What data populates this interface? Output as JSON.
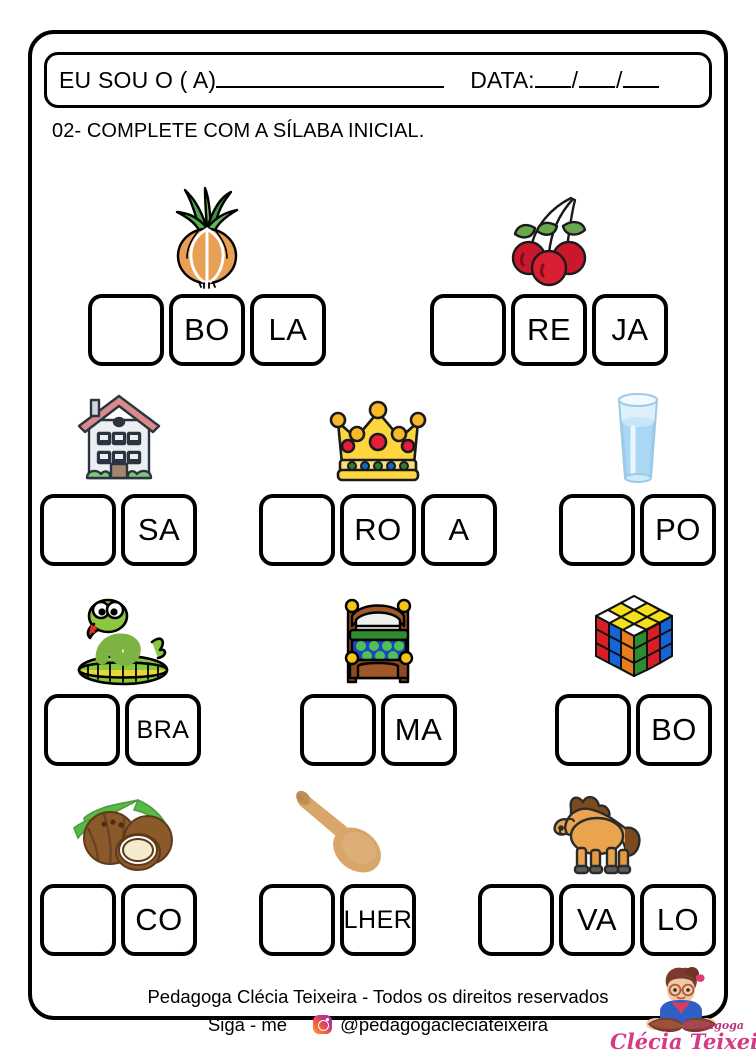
{
  "header": {
    "name_label": "EU SOU O ( A)",
    "date_label": "DATA:",
    "slash": "/"
  },
  "instruction": "02- COMPLETE  COM A SÍLABA INICIAL.",
  "exercise_rows": [
    {
      "row_index": 1,
      "items": [
        {
          "picture": "onion-icon",
          "answer_word": "CEBOLA",
          "boxes": [
            "",
            "BO",
            "LA"
          ]
        },
        {
          "picture": "cherries-icon",
          "answer_word": "CEREJA",
          "boxes": [
            "",
            "RE",
            "JA"
          ]
        }
      ]
    },
    {
      "row_index": 2,
      "items": [
        {
          "picture": "house-icon",
          "answer_word": "CASA",
          "boxes": [
            "",
            "SA"
          ]
        },
        {
          "picture": "crown-icon",
          "answer_word": "COROA",
          "boxes": [
            "",
            "RO",
            "A"
          ]
        },
        {
          "picture": "water-glass-icon",
          "answer_word": "COPO",
          "boxes": [
            "",
            "PO"
          ]
        }
      ]
    },
    {
      "row_index": 3,
      "items": [
        {
          "picture": "snake-icon",
          "answer_word": "COBRA",
          "boxes": [
            "",
            "BRA"
          ]
        },
        {
          "picture": "bed-icon",
          "answer_word": "CAMA",
          "boxes": [
            "",
            "MA"
          ]
        },
        {
          "picture": "rubiks-cube-icon",
          "answer_word": "CUBO",
          "boxes": [
            "",
            "BO"
          ]
        }
      ]
    },
    {
      "row_index": 4,
      "items": [
        {
          "picture": "coconut-icon",
          "answer_word": "COCO",
          "boxes": [
            "",
            "CO"
          ]
        },
        {
          "picture": "wooden-spoon-icon",
          "answer_word": "COLHER",
          "boxes": [
            "",
            "LHER"
          ]
        },
        {
          "picture": "horse-icon",
          "answer_word": "CAVALO",
          "boxes": [
            "",
            "VA",
            "LO"
          ]
        }
      ]
    }
  ],
  "footer": {
    "copyright": "Pedagoga Clécia Teixeira - Todos os direitos reservados",
    "follow_label": "Siga - me",
    "instagram_handle": "@pedagogacleciateixeira",
    "logo_script": "Clécia Teixeira",
    "logo_small": "Pedagoga"
  },
  "colors": {
    "ink": "#000000",
    "paper": "#ffffff",
    "brand_pink": "#d63a84"
  }
}
